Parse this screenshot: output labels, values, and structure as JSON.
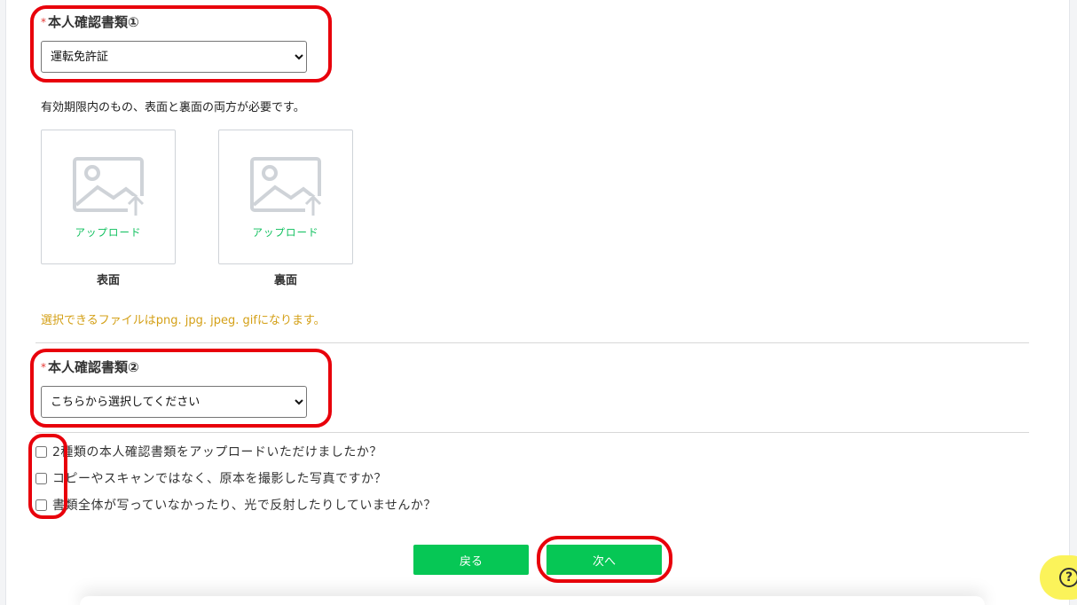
{
  "doc1": {
    "required_mark": "*",
    "label": "本人確認書類①",
    "selected": "運転免許証",
    "note": "有効期限内のもの、表面と裏面の両方が必要です。"
  },
  "uploads": [
    {
      "button_text": "アップロード",
      "label": "表面"
    },
    {
      "button_text": "アップロード",
      "label": "裏面"
    }
  ],
  "file_types_note": "選択できるファイルはpng. jpg. jpeg. gifになります。",
  "doc2": {
    "required_mark": "*",
    "label": "本人確認書類②",
    "selected": "こちらから選択してください"
  },
  "checks": [
    "2種類の本人確認書類をアップロードいただけましたか？",
    "コピーやスキャンではなく、原本を撮影した写真ですか？",
    "書類全体が写っていなかったり、光で反射したりしていませんか？"
  ],
  "buttons": {
    "back": "戻る",
    "next": "次へ"
  },
  "help": {
    "symbol": "?"
  },
  "colors": {
    "accent": "#06c755",
    "highlight": "#e8000b",
    "warning": "#d4a017",
    "required": "#e53935",
    "help_bg": "#fbf35a"
  }
}
